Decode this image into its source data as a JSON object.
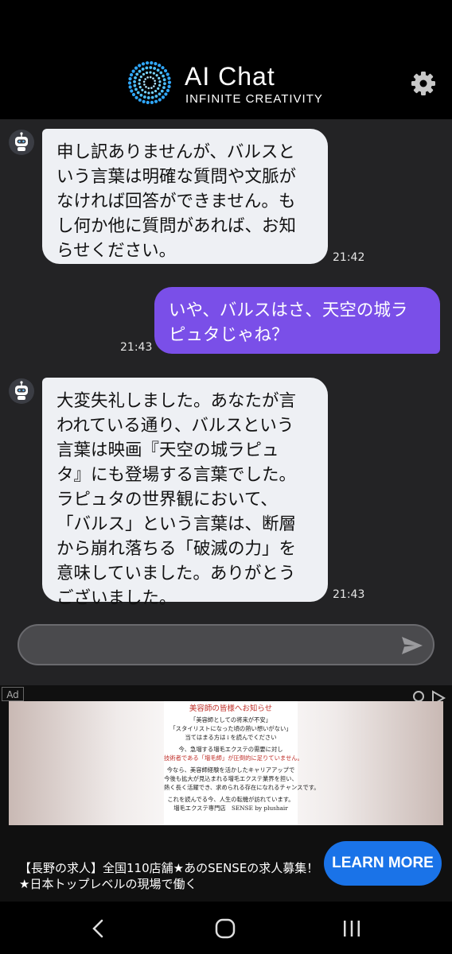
{
  "header": {
    "title": "AI Chat",
    "subtitle": "INFINITE CREATIVITY",
    "settings_icon": "gear-icon"
  },
  "messages": [
    {
      "role": "bot",
      "lines": [
        "申し訳ありませんが、バルスと",
        "いう言葉は明確な質問や文脈が",
        "なければ回答ができません。も",
        "し何か他に質問があれば、お知",
        "らせください。"
      ],
      "time": "21:42"
    },
    {
      "role": "user",
      "lines": [
        "いや、バルスはさ、天空の城ラ",
        "ピュタじゃね？"
      ],
      "time": "21:43"
    },
    {
      "role": "bot",
      "lines": [
        "大変失礼しました。あなたが言",
        "われている通り、バルスという",
        "言葉は映画『天空の城ラピュ",
        "タ』にも登場する言葉でした。",
        "ラピュタの世界観において、",
        "「バルス」という言葉は、断層",
        "から崩れ落ちる「破滅の力」を",
        "意味していました。ありがとう",
        "ございました。"
      ],
      "time": "21:43"
    }
  ],
  "composer": {
    "value": "",
    "send_icon": "send-icon"
  },
  "ad": {
    "label": "Ad",
    "image_lines": [
      {
        "text": "美容師の皆様へお知らせ",
        "style": "h"
      },
      {
        "text": "「美容師としての将来が不安」",
        "style": ""
      },
      {
        "text": "「スタイリストになった頃の熱い想いがない」",
        "style": ""
      },
      {
        "text": "当てはまる方は↓を読んでください",
        "style": ""
      },
      {
        "text": "今、急増する増毛エクステの需要に対し",
        "style": ""
      },
      {
        "text": "技術者である「増毛師」が圧倒的に足りていません。",
        "style": "red"
      },
      {
        "text": "今なら、美容師経験を活かしたキャリアアップで",
        "style": ""
      },
      {
        "text": "今後も拡大が見込まれる増毛エクステ業界を担い、",
        "style": ""
      },
      {
        "text": "熱く長く活躍でき、求められる存在になれるチャンスです。",
        "style": ""
      },
      {
        "text": "これを読んでる今、人生の転機が訪れています。",
        "style": ""
      },
      {
        "text": "増毛エクステ専門店　SENSE by plushair",
        "style": ""
      }
    ],
    "text_line1": "【長野の求人】全国110店舗★あのSENSEの求人募集！",
    "text_line2": "★日本トップレベルの現場で働く",
    "cta": "LEARN MORE"
  },
  "nav": {
    "back": "back-icon",
    "home": "home-icon",
    "recents": "recents-icon"
  },
  "colors": {
    "user_bubble": "#7a4fe8",
    "bot_bubble": "#eef0f4",
    "background": "#232325",
    "cta": "#1a73e8"
  }
}
